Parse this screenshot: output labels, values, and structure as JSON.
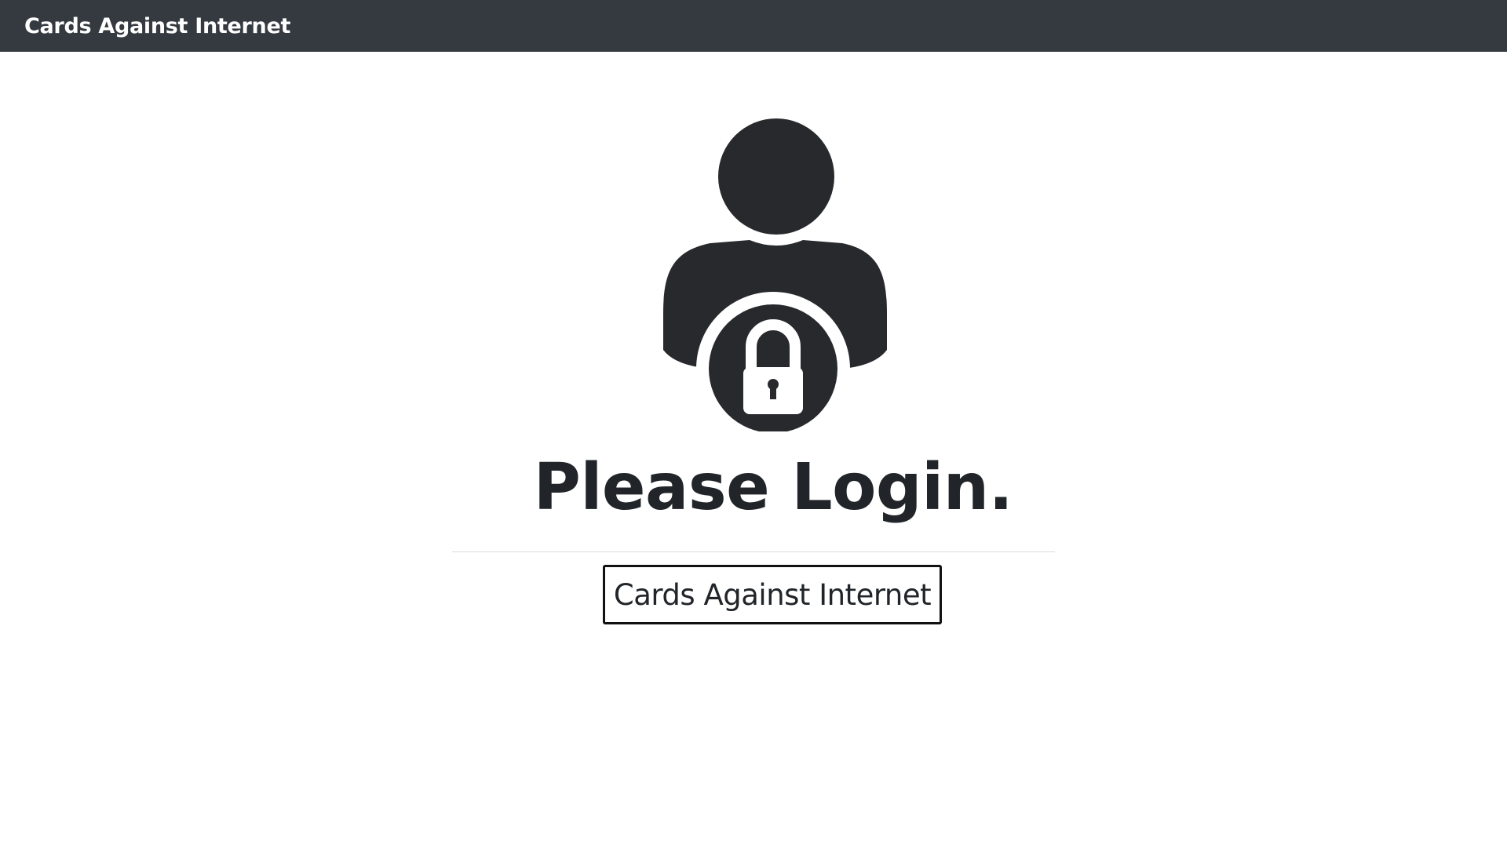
{
  "navbar": {
    "brand": "Cards Against Internet"
  },
  "main": {
    "icon": "user-lock-icon",
    "heading": "Please Login.",
    "login_button_label": "Cards Against Internet"
  },
  "colors": {
    "navbar_bg": "#343a40",
    "icon": "#28292c",
    "text": "#212529"
  }
}
